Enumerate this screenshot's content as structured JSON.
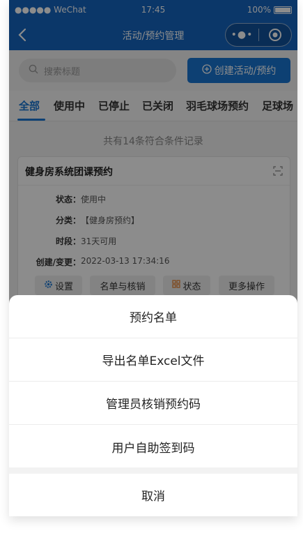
{
  "status_bar": {
    "carrier": "●●●●● WeChat",
    "time": "17:45",
    "battery": "100%"
  },
  "nav": {
    "title": "活动/预约管理",
    "more_icon": "more-dots-icon",
    "target_icon": "target-icon"
  },
  "search": {
    "placeholder": "搜索标题",
    "create_label": "创建活动/预约"
  },
  "tabs": [
    {
      "label": "全部",
      "active": true
    },
    {
      "label": "使用中"
    },
    {
      "label": "已停止"
    },
    {
      "label": "已关闭"
    },
    {
      "label": "羽毛球场预约"
    },
    {
      "label": "足球场"
    }
  ],
  "list": {
    "count_text": "共有14条符合条件记录",
    "card": {
      "title": "健身房系统团课预约",
      "rows": [
        {
          "label": "状态：",
          "value": "使用中"
        },
        {
          "label": "分类：",
          "value": "【健身房预约】"
        },
        {
          "label": "时段：",
          "value": "31天可用"
        },
        {
          "label": "创建/变更：",
          "value": "2022-03-13 17:34:16"
        }
      ],
      "actions": {
        "settings": "设置",
        "roster": "名单与核销",
        "status": "状态",
        "more": "更多操作"
      }
    }
  },
  "action_sheet": {
    "items": [
      "预约名单",
      "导出名单Excel文件",
      "管理员核销预约码",
      "用户自助签到码"
    ],
    "cancel": "取消"
  },
  "colors": {
    "primary": "#1565c0",
    "accent": "#1976d2",
    "status_orange": "#e8863a"
  }
}
